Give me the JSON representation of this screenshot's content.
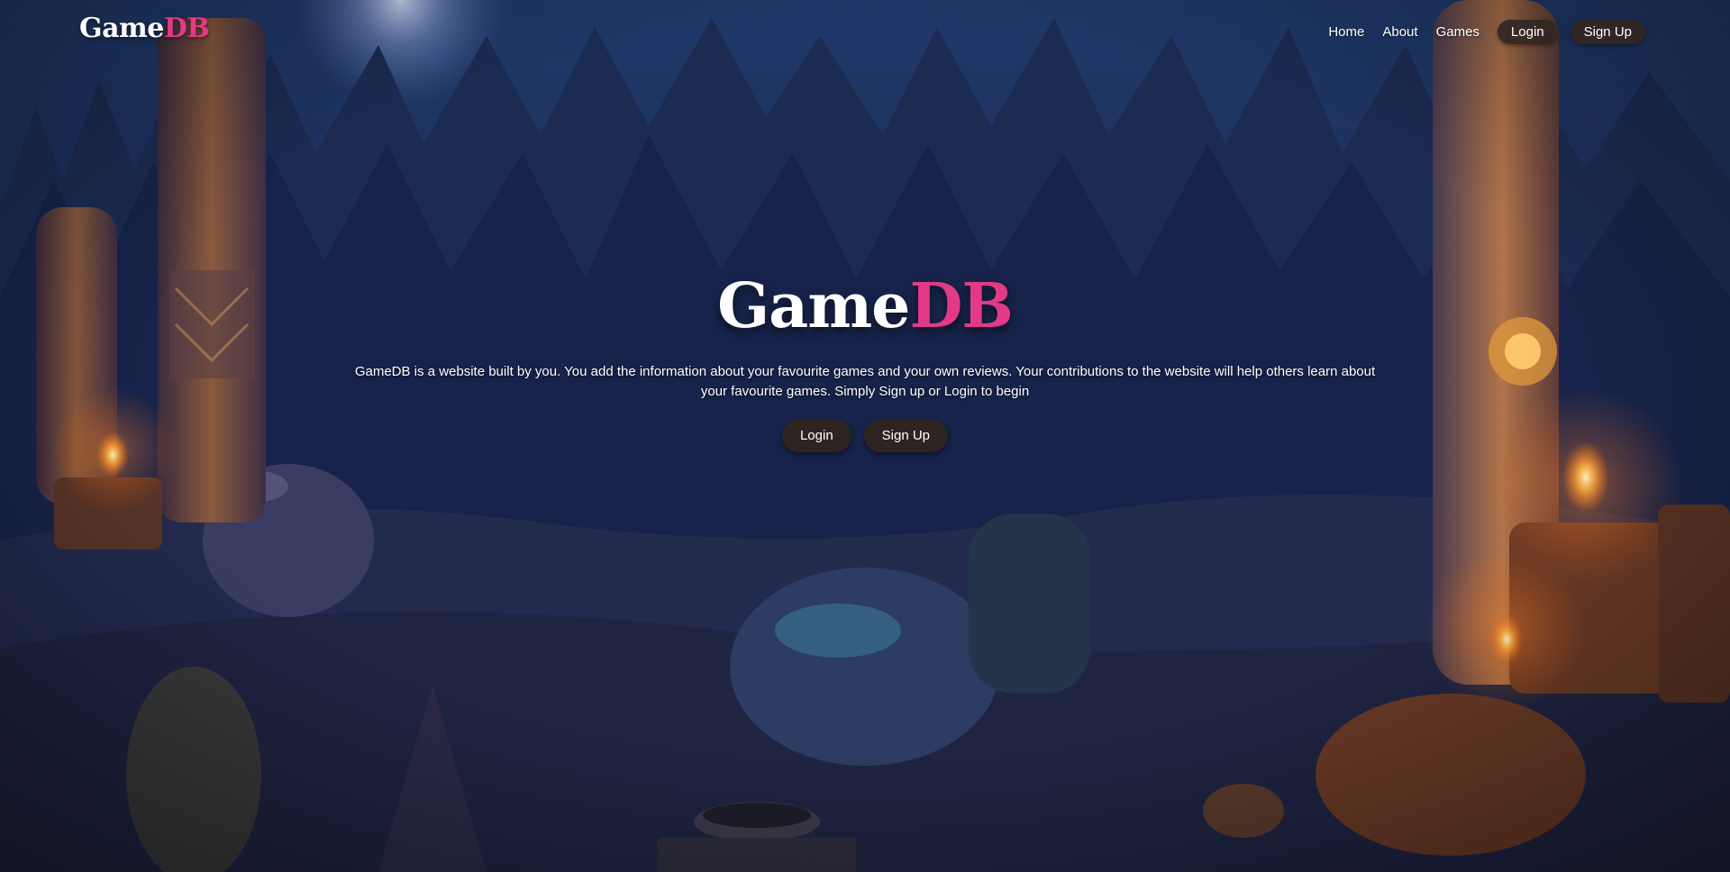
{
  "brand": {
    "part1": "Game",
    "part2": "DB"
  },
  "nav": {
    "home": "Home",
    "about": "About",
    "games": "Games",
    "login": "Login",
    "signup": "Sign Up"
  },
  "hero": {
    "title_part1": "Game",
    "title_part2": "DB",
    "description": "GameDB is a website built by you. You add the information about your favourite games and your own reviews. Your contributions to the website will help others learn about your favourite games. Simply Sign up or Login to begin",
    "login_label": "Login",
    "signup_label": "Sign Up"
  },
  "colors": {
    "accent": "#e23a86",
    "button_bg": "#302420",
    "sky": "#1c2646"
  }
}
